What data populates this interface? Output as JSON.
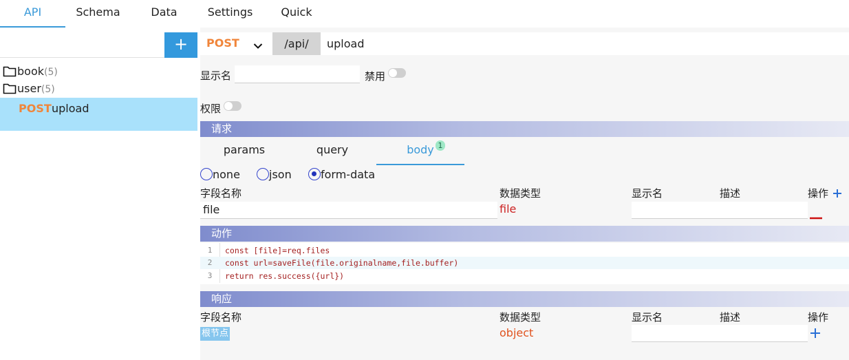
{
  "nav": {
    "tabs": [
      {
        "label": "API",
        "active": true
      },
      {
        "label": "Schema",
        "active": false
      },
      {
        "label": "Data",
        "active": false
      },
      {
        "label": "Settings",
        "active": false
      },
      {
        "label": "Quick",
        "active": false
      }
    ]
  },
  "sidebar": {
    "add_label": "+",
    "folders": [
      {
        "name": "book",
        "count": "(5)"
      },
      {
        "name": "user",
        "count": "(5)"
      }
    ],
    "api_items": [
      {
        "method": "POST",
        "name": "upload",
        "selected": true
      }
    ]
  },
  "request_line": {
    "method": "POST",
    "prefix": "/api/",
    "path": "upload"
  },
  "form": {
    "display_name_label": "显示名",
    "display_name_value": "",
    "disabled_label": "禁用",
    "disabled_on": false,
    "permission_label": "权限",
    "permission_on": false
  },
  "request_section": {
    "title": "请求",
    "tabs": [
      {
        "label": "params",
        "active": false
      },
      {
        "label": "query",
        "active": false
      },
      {
        "label": "body",
        "active": true,
        "badge": "1"
      }
    ],
    "body_types": [
      {
        "label": "none",
        "checked": false
      },
      {
        "label": "json",
        "checked": false
      },
      {
        "label": "form-data",
        "checked": true
      }
    ],
    "columns": {
      "field": "字段名称",
      "type": "数据类型",
      "display": "显示名",
      "desc": "描述",
      "ops": "操作"
    },
    "rows": [
      {
        "field": "file",
        "type": "file",
        "display": "",
        "desc": ""
      }
    ]
  },
  "action_section": {
    "title": "动作",
    "lines": [
      {
        "no": "1",
        "code": "const [file]=req.files"
      },
      {
        "no": "2",
        "code": "const url=saveFile(file.originalname,file.buffer)"
      },
      {
        "no": "3",
        "code": "return res.success({url})"
      }
    ],
    "highlighted_line": 2
  },
  "response_section": {
    "title": "响应",
    "columns": {
      "field": "字段名称",
      "type": "数据类型",
      "display": "显示名",
      "desc": "描述",
      "ops": "操作"
    },
    "rows": [
      {
        "field": "根节点",
        "type": "object",
        "display": "",
        "desc": ""
      }
    ]
  },
  "colors": {
    "accent": "#3a9ad9",
    "method_post": "#f0853a",
    "type_red": "#cc2222",
    "selected_row": "#a9e1fb",
    "section_bar_start": "#7f8ccd"
  }
}
